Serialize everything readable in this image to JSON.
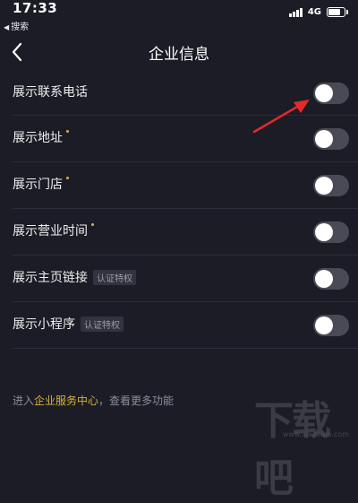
{
  "status_bar": {
    "time": "17:33",
    "back_app": "搜索",
    "network": "4G"
  },
  "nav": {
    "title": "企业信息"
  },
  "settings": [
    {
      "label": "展示联系电话",
      "required": false,
      "badge": "",
      "enabled": false
    },
    {
      "label": "展示地址",
      "required": true,
      "badge": "",
      "enabled": false
    },
    {
      "label": "展示门店",
      "required": true,
      "badge": "",
      "enabled": false
    },
    {
      "label": "展示营业时间",
      "required": true,
      "badge": "",
      "enabled": false
    },
    {
      "label": "展示主页链接",
      "required": false,
      "badge": "认证特权",
      "enabled": false
    },
    {
      "label": "展示小程序",
      "required": false,
      "badge": "认证特权",
      "enabled": false
    }
  ],
  "footer": {
    "prefix": "进入",
    "link": "企业服务中心",
    "suffix": "，查看更多功能"
  },
  "watermark": {
    "text": "下载吧",
    "url": "www.xiazaiba.com"
  },
  "colors": {
    "background": "#1c1c26",
    "accent": "#d8b23b",
    "arrow": "#e02b2b",
    "toggle_off": "#4a4a56"
  }
}
